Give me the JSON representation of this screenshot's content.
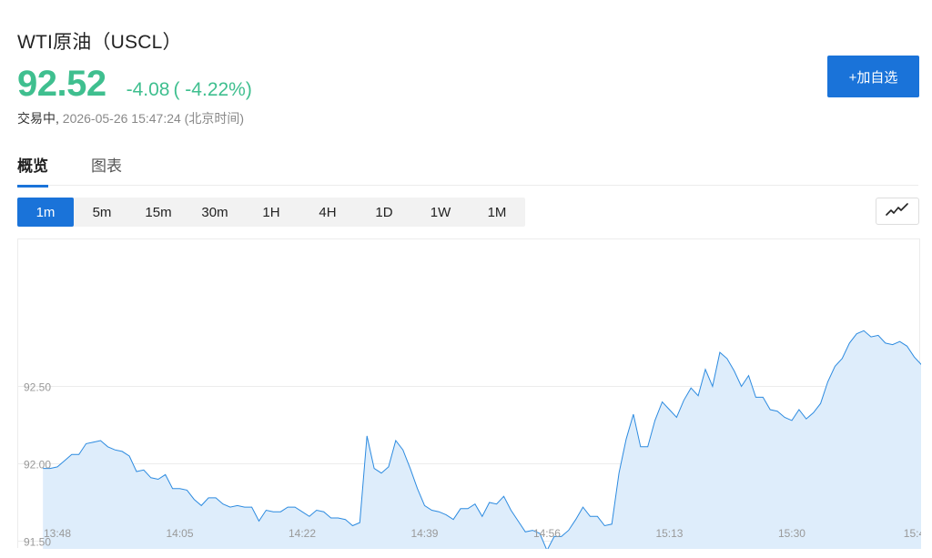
{
  "header": {
    "title": "WTI原油（USCL）",
    "price": "92.52",
    "change": "-4.08",
    "change_pct": "( -4.22%)",
    "status": "交易中,",
    "timestamp": "2026-05-26 15:47:24 (北京时间)",
    "add_watchlist_label": "+加自选",
    "accent_color": "#3fbf8f",
    "button_color": "#1a73d9"
  },
  "tabs": [
    {
      "label": "概览",
      "active": true
    },
    {
      "label": "图表",
      "active": false
    }
  ],
  "periods": [
    {
      "label": "1m",
      "active": true
    },
    {
      "label": "5m",
      "active": false
    },
    {
      "label": "15m",
      "active": false
    },
    {
      "label": "30m",
      "active": false
    },
    {
      "label": "1H",
      "active": false
    },
    {
      "label": "4H",
      "active": false
    },
    {
      "label": "1D",
      "active": false
    },
    {
      "label": "1W",
      "active": false
    },
    {
      "label": "1M",
      "active": false
    }
  ],
  "chart_type_icon": "line-chart-icon",
  "chart_data": {
    "type": "area",
    "title": "",
    "xlabel": "",
    "ylabel": "",
    "ylim": [
      91.45,
      93.45
    ],
    "yticks": [
      91.5,
      92.0,
      92.5
    ],
    "ytick_labels": [
      "91.50",
      "92.00",
      "92.50"
    ],
    "xtick_labels": [
      "13:48",
      "14:05",
      "14:22",
      "14:39",
      "14:56",
      "15:13",
      "15:30",
      "15:4"
    ],
    "xtick_minutes": [
      0,
      17,
      34,
      51,
      68,
      85,
      102,
      119
    ],
    "grid": true,
    "line_color": "#2d8be0",
    "fill_color": "#deedfb",
    "series": [
      {
        "values": [
          91.97,
          91.97,
          91.98,
          92.02,
          92.06,
          92.06,
          92.13,
          92.14,
          92.15,
          92.11,
          92.09,
          92.08,
          92.05,
          91.95,
          91.96,
          91.91,
          91.9,
          91.93,
          91.84,
          91.84,
          91.83,
          91.77,
          91.73,
          91.78,
          91.78,
          91.74,
          91.72,
          91.73,
          91.72,
          91.72,
          91.63,
          91.7,
          91.69,
          91.69,
          91.72,
          91.72,
          91.69,
          91.66,
          91.7,
          91.69,
          91.65,
          91.65,
          91.64,
          91.6,
          91.62,
          92.18,
          91.97,
          91.94,
          91.98,
          92.15,
          92.09,
          91.97,
          91.84,
          91.73,
          91.7,
          91.69,
          91.67,
          91.64,
          91.71,
          91.71,
          91.74,
          91.66,
          91.75,
          91.74,
          91.79,
          91.7,
          91.63,
          91.56,
          91.57,
          91.55,
          91.44,
          91.53,
          91.53,
          91.57,
          91.64,
          91.72,
          91.66,
          91.66,
          91.6,
          91.61,
          91.94,
          92.16,
          92.32,
          92.11,
          92.11,
          92.28,
          92.4,
          92.35,
          92.3,
          92.41,
          92.49,
          92.44,
          92.61,
          92.5,
          92.72,
          92.68,
          92.6,
          92.5,
          92.57,
          92.43,
          92.43,
          92.35,
          92.34,
          92.3,
          92.28,
          92.35,
          92.29,
          92.33,
          92.39,
          92.53,
          92.63,
          92.68,
          92.78,
          92.84,
          92.86,
          92.82,
          92.83,
          92.78,
          92.77,
          92.79,
          92.76,
          92.69,
          92.64,
          92.53,
          92.53
        ]
      }
    ]
  }
}
